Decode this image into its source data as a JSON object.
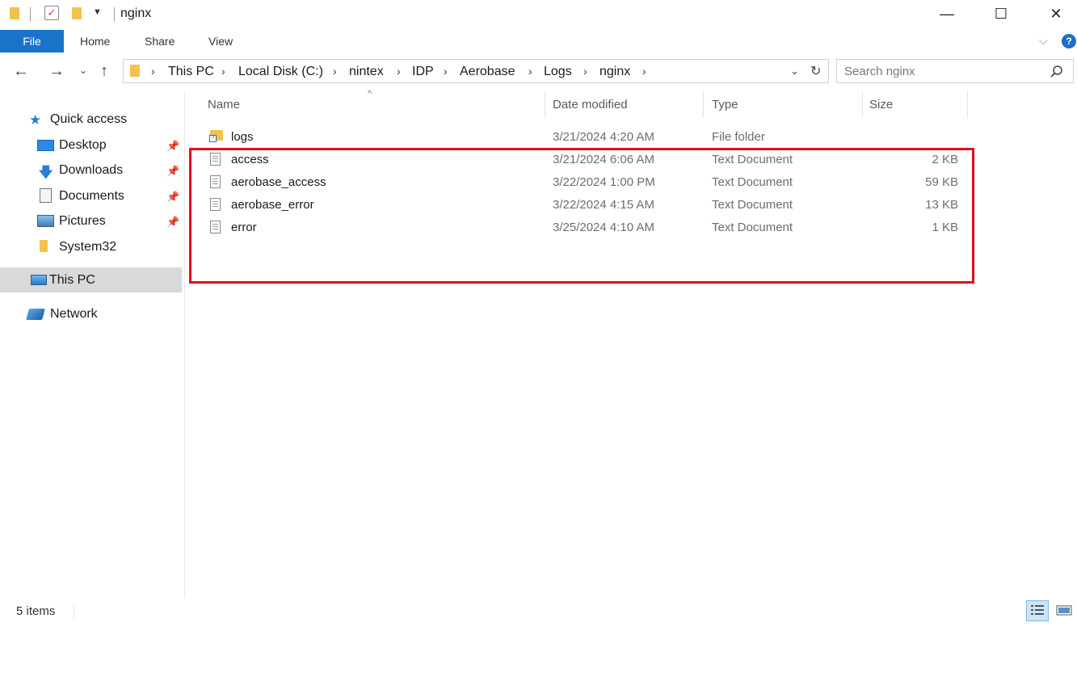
{
  "window": {
    "title": "nginx",
    "controls": {
      "minimize": "—",
      "maximize": "☐",
      "close": "✕"
    }
  },
  "ribbon": {
    "tabs": [
      "File",
      "Home",
      "Share",
      "View"
    ],
    "help_label": "?"
  },
  "address": {
    "breadcrumbs": [
      "This PC",
      "Local Disk (C:)",
      "nintex",
      "IDP",
      "Aerobase",
      "Logs",
      "nginx"
    ],
    "search_placeholder": "Search nginx"
  },
  "nav_pane": {
    "items": [
      {
        "label": "Quick access",
        "icon": "star-icon"
      },
      {
        "label": "Desktop",
        "icon": "desktop-icon",
        "pinned": true
      },
      {
        "label": "Downloads",
        "icon": "download-arrow-icon",
        "pinned": true
      },
      {
        "label": "Documents",
        "icon": "documents-icon",
        "pinned": true
      },
      {
        "label": "Pictures",
        "icon": "pictures-icon",
        "pinned": true
      },
      {
        "label": "System32",
        "icon": "folder-icon"
      },
      {
        "label": "This PC",
        "icon": "computer-icon",
        "selected": true
      },
      {
        "label": "Network",
        "icon": "network-icon"
      }
    ]
  },
  "file_list": {
    "columns": [
      "Name",
      "Date modified",
      "Type",
      "Size"
    ],
    "rows": [
      {
        "name": "logs",
        "date": "3/21/2024 4:20 AM",
        "type": "File folder",
        "size": "",
        "icon": "folder-shortcut-icon"
      },
      {
        "name": "access",
        "date": "3/21/2024 6:06 AM",
        "type": "Text Document",
        "size": "2 KB",
        "icon": "text-document-icon"
      },
      {
        "name": "aerobase_access",
        "date": "3/22/2024 1:00 PM",
        "type": "Text Document",
        "size": "59 KB",
        "icon": "text-document-icon"
      },
      {
        "name": "aerobase_error",
        "date": "3/22/2024 4:15 AM",
        "type": "Text Document",
        "size": "13 KB",
        "icon": "text-document-icon"
      },
      {
        "name": "error",
        "date": "3/25/2024 4:10 AM",
        "type": "Text Document",
        "size": "1 KB",
        "icon": "text-document-icon"
      }
    ],
    "highlight_color": "#e00d1f"
  },
  "status_bar": {
    "item_count": "5 items"
  },
  "colors": {
    "accent": "#1a73c8",
    "selection": "#d9d9d9"
  }
}
